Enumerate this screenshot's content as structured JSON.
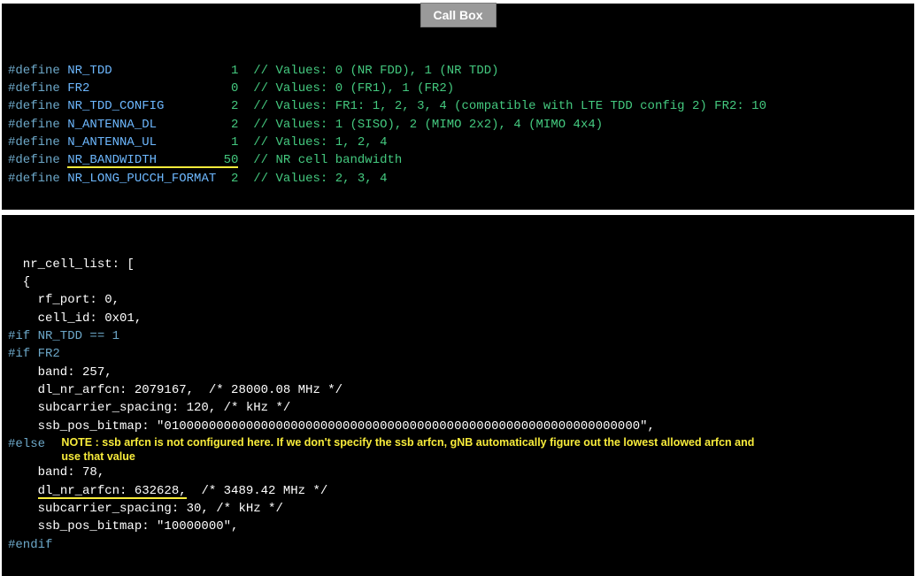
{
  "callbox_label": "Call Box",
  "top_panel": {
    "lines": [
      {
        "kw": "#define",
        "name": "NR_TDD",
        "val": "1",
        "comment": "// Values: 0 (NR FDD), 1 (NR TDD)"
      },
      {
        "kw": "#define",
        "name": "FR2",
        "val": "0",
        "comment": "// Values: 0 (FR1), 1 (FR2)"
      },
      {
        "kw": "#define",
        "name": "NR_TDD_CONFIG",
        "val": "2",
        "comment": "// Values: FR1: 1, 2, 3, 4 (compatible with LTE TDD config 2) FR2: 10"
      },
      {
        "kw": "#define",
        "name": "N_ANTENNA_DL",
        "val": "2",
        "comment": "// Values: 1 (SISO), 2 (MIMO 2x2), 4 (MIMO 4x4)"
      },
      {
        "kw": "#define",
        "name": "N_ANTENNA_UL",
        "val": "1",
        "comment": "// Values: 1, 2, 4"
      },
      {
        "kw": "#define",
        "name": "NR_BANDWIDTH",
        "val": "50",
        "comment": "// NR cell bandwidth",
        "underline": true
      },
      {
        "kw": "#define",
        "name": "NR_LONG_PUCCH_FORMAT",
        "val": "2",
        "comment": "// Values: 2, 3, 4"
      }
    ]
  },
  "bottom_panel": {
    "head": [
      "  nr_cell_list: [",
      "  {",
      "    rf_port: 0,",
      "    cell_id: 0x01,"
    ],
    "if_line": "#if NR_TDD == 1",
    "if2_line": "#if FR2",
    "fr2_block": [
      "    band: 257,",
      "    dl_nr_arfcn: 2079167,  /* 28000.08 MHz */",
      "    subcarrier_spacing: 120, /* kHz */",
      "    ssb_pos_bitmap: \"0100000000000000000000000000000000000000000000000000000000000000\","
    ],
    "else_line": "#else",
    "note": "NOTE : ssb arfcn is not configured here. If we don't specify the ssb arfcn, gNB automatically figure out the lowest allowed arfcn and use that value",
    "fr1_block_pre": "    band: 78,",
    "fr1_arfcn_lead": "    ",
    "fr1_arfcn_ul": "dl_nr_arfcn: 632628,",
    "fr1_arfcn_rest": "  /* 3489.42 MHz */",
    "fr1_block_post": [
      "    subcarrier_spacing: 30, /* kHz */",
      "    ssb_pos_bitmap: \"10000000\","
    ],
    "endif_line": "#endif"
  }
}
